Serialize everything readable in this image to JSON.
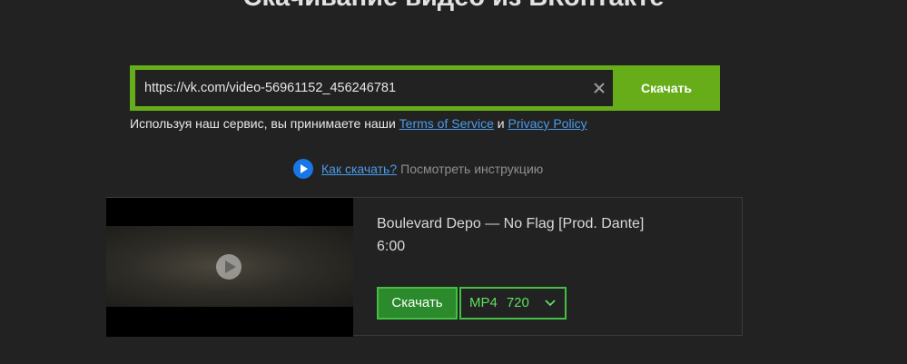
{
  "header": {
    "title": "Скачивание видео из ВКонтакте"
  },
  "search": {
    "url_value": "https://vk.com/video-56961152_456246781",
    "clear_icon": "close-icon",
    "download_label": "Скачать"
  },
  "terms": {
    "prefix": "Используя наш сервис, вы принимаете наши ",
    "tos_link": "Terms of Service",
    "and": " и ",
    "privacy_link": "Privacy Policy"
  },
  "howto": {
    "icon": "play-circle-icon",
    "link": "Как скачать?",
    "hint": "Посмотреть инструкцию"
  },
  "result": {
    "title": "Boulevard Depo — No Flag [Prod. Dante]",
    "duration": "6:00",
    "download_label": "Скачать",
    "format": "MP4",
    "quality": "720"
  },
  "colors": {
    "background": "#222222",
    "search_accent": "#67ad1a",
    "link": "#4a9bea",
    "result_accent": "#43c043"
  }
}
